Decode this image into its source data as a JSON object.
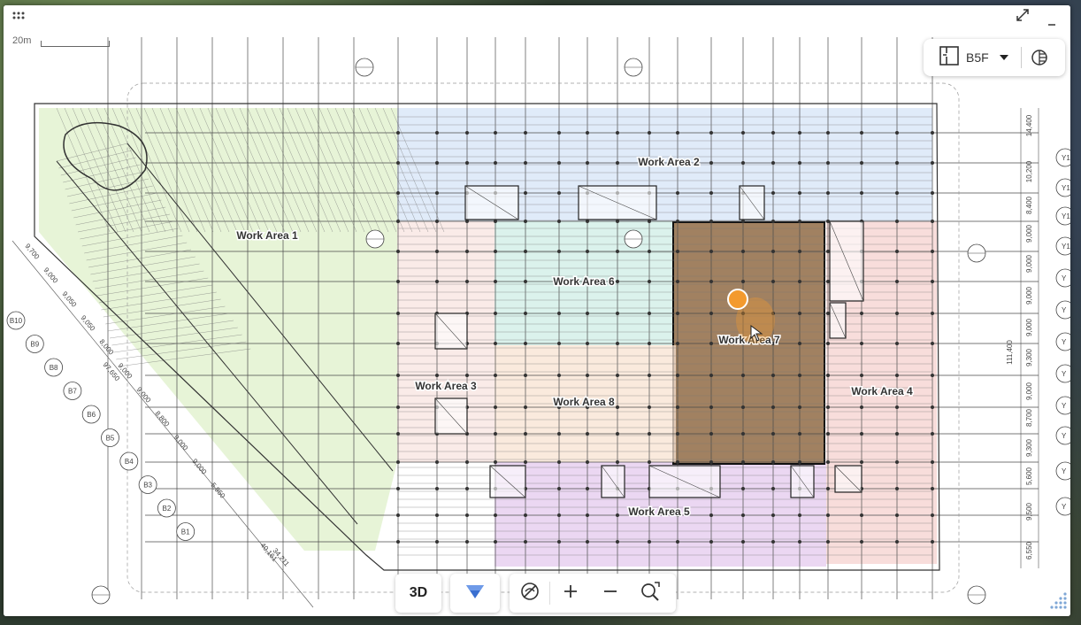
{
  "window": {
    "menu_icon": "grid-dots-icon",
    "expand_icon": "expand-icon",
    "minimize_icon": "minimize-icon"
  },
  "scale": {
    "label": "20m"
  },
  "floor_selector": {
    "icon": "floor-plan-icon",
    "selected": "B5F",
    "layers_icon": "layers-icon"
  },
  "work_areas": [
    {
      "label": "Work Area 1",
      "color": "#dff0c9"
    },
    {
      "label": "Work Area 2",
      "color": "#d6e4f7"
    },
    {
      "label": "Work Area 3",
      "color": "#f8e4e0"
    },
    {
      "label": "Work Area 4",
      "color": "#f6d2cf"
    },
    {
      "label": "Work Area 5",
      "color": "#e4c9ee"
    },
    {
      "label": "Work Area 6",
      "color": "#cfeee6"
    },
    {
      "label": "Work Area 7",
      "color": "#9c7a58"
    },
    {
      "label": "Work Area 8",
      "color": "#f8e3d2"
    }
  ],
  "selected_area": "Work Area 7",
  "marker_color": "#f39a2e",
  "toolbar": {
    "btn_3d": "3D",
    "filter_icon": "filter-icon",
    "hide_icon": "visibility-off-icon",
    "zoom_in_icon": "zoom-in-icon",
    "zoom_out_icon": "zoom-out-icon",
    "zoom_fit_icon": "zoom-fit-icon"
  },
  "axis_labels_left": [
    "B10",
    "B9",
    "B8",
    "B7",
    "B6",
    "B5",
    "B4",
    "B3",
    "B2",
    "B1"
  ],
  "axis_labels_right": [
    "Y1",
    "Y1",
    "Y1",
    "Y1",
    "Y",
    "Y",
    "Y",
    "Y",
    "Y",
    "Y",
    "Y",
    "Y"
  ],
  "dimensions_right": [
    "14,400",
    "10,200",
    "8,400",
    "9,000",
    "9,000",
    "9,000",
    "9,000",
    "9,300",
    "9,000",
    "8,700",
    "9,300",
    "5,600",
    "9,500",
    "6,550"
  ],
  "dimension_total_right": "111,400",
  "dimensions_left": [
    "9,700",
    "9,000",
    "9,050",
    "9,050",
    "8,000",
    "9,000",
    "9,000",
    "8,800",
    "9,000",
    "9,000",
    "5,950"
  ],
  "dimension_total_left": "97,650",
  "dimension_bottom_left": "34,211",
  "dimension_bottom_left2": "40,161"
}
